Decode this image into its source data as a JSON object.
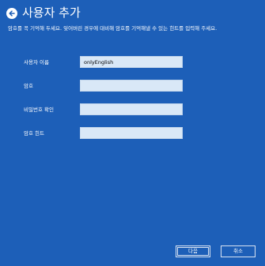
{
  "header": {
    "title": "사용자 추가"
  },
  "description": "암호를 꼭 기억해 두세요. 잊어버린 경우에 대비해 암호를 기억해낼 수 있는 힌트를 입력해 주세요.",
  "form": {
    "username": {
      "label": "사용자 이름",
      "value": "onlyEnglish"
    },
    "password": {
      "label": "암호",
      "value": ""
    },
    "confirm_password": {
      "label": "비밀번호 확인",
      "value": ""
    },
    "password_hint": {
      "label": "암호 힌트",
      "value": ""
    }
  },
  "footer": {
    "next_label": "다음",
    "cancel_label": "취소"
  },
  "colors": {
    "background": "#1d5fb8",
    "field": "#d9e8f7"
  },
  "icons": {
    "back": "back-arrow-icon"
  }
}
